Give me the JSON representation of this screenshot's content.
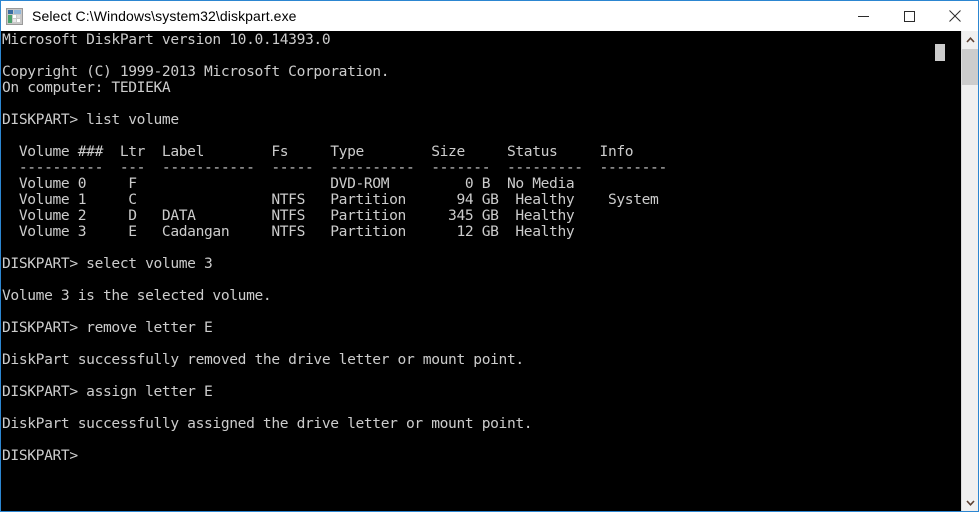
{
  "window": {
    "title": "Select C:\\Windows\\system32\\diskpart.exe",
    "icon": "console-app-icon",
    "border_color": "#2c86d1",
    "titlebar_background": "#ffffff",
    "console_background": "#000000",
    "console_foreground": "#cccccc"
  },
  "caption_buttons": {
    "minimize_label": "Minimize",
    "maximize_label": "Maximize",
    "close_label": "Close"
  },
  "scrollbar": {
    "up_arrow_label": "Scroll up",
    "down_arrow_label": "Scroll down",
    "thumb_label": "Scroll thumb"
  },
  "console": {
    "prompt": "DISKPART>",
    "cursor_visible": true,
    "lines": [
      "Microsoft DiskPart version 10.0.14393.0",
      "",
      "Copyright (C) 1999-2013 Microsoft Corporation.",
      "On computer: TEDIEKA",
      "",
      "DISKPART> list volume",
      "",
      "  Volume ###  Ltr  Label        Fs     Type        Size     Status     Info",
      "  ----------  ---  -----------  -----  ----------  -------  ---------  --------",
      "  Volume 0     F                       DVD-ROM         0 B  No Media",
      "  Volume 1     C                NTFS   Partition      94 GB  Healthy    System",
      "  Volume 2     D   DATA         NTFS   Partition     345 GB  Healthy",
      "  Volume 3     E   Cadangan     NTFS   Partition      12 GB  Healthy",
      "",
      "DISKPART> select volume 3",
      "",
      "Volume 3 is the selected volume.",
      "",
      "DISKPART> remove letter E",
      "",
      "DiskPart successfully removed the drive letter or mount point.",
      "",
      "DISKPART> assign letter E",
      "",
      "DiskPart successfully assigned the drive letter or mount point.",
      "",
      "DISKPART>"
    ],
    "volume_table": {
      "headers": [
        "Volume ###",
        "Ltr",
        "Label",
        "Fs",
        "Type",
        "Size",
        "Status",
        "Info"
      ],
      "rows": [
        [
          "Volume 0",
          "F",
          "",
          "",
          "DVD-ROM",
          "0 B",
          "No Media",
          ""
        ],
        [
          "Volume 1",
          "C",
          "",
          "NTFS",
          "Partition",
          "94 GB",
          "Healthy",
          "System"
        ],
        [
          "Volume 2",
          "D",
          "DATA",
          "NTFS",
          "Partition",
          "345 GB",
          "Healthy",
          ""
        ],
        [
          "Volume 3",
          "E",
          "Cadangan",
          "NTFS",
          "Partition",
          "12 GB",
          "Healthy",
          ""
        ]
      ]
    },
    "commands": [
      "list volume",
      "select volume 3",
      "remove letter E",
      "assign letter E"
    ],
    "messages": [
      "Microsoft DiskPart version 10.0.14393.0",
      "Copyright (C) 1999-2013 Microsoft Corporation.",
      "On computer: TEDIEKA",
      "Volume 3 is the selected volume.",
      "DiskPart successfully removed the drive letter or mount point.",
      "DiskPart successfully assigned the drive letter or mount point."
    ]
  }
}
